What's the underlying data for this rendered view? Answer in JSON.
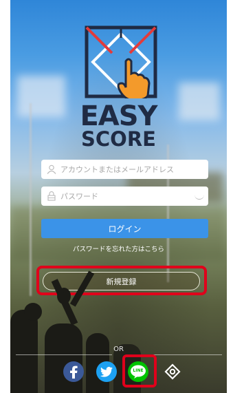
{
  "app": {
    "brand_line1": "EASY",
    "brand_line2": "SCORE"
  },
  "form": {
    "account_placeholder": "アカウントまたはメールアドレス",
    "password_placeholder": "パスワード",
    "login_label": "ログイン",
    "forgot_label": "パスワードを忘れた方はこちら",
    "register_label": "新規登録"
  },
  "social": {
    "divider_label": "OR",
    "line_label": "LINE",
    "items": [
      "facebook-icon",
      "twitter-icon",
      "line-icon",
      "other-login-icon"
    ]
  },
  "colors": {
    "accent": "#3b93e8",
    "brand_text": "#1f2b44",
    "highlight": "#e0001b",
    "facebook": "#3b5998",
    "twitter": "#1da1f2",
    "line": "#00c300"
  }
}
